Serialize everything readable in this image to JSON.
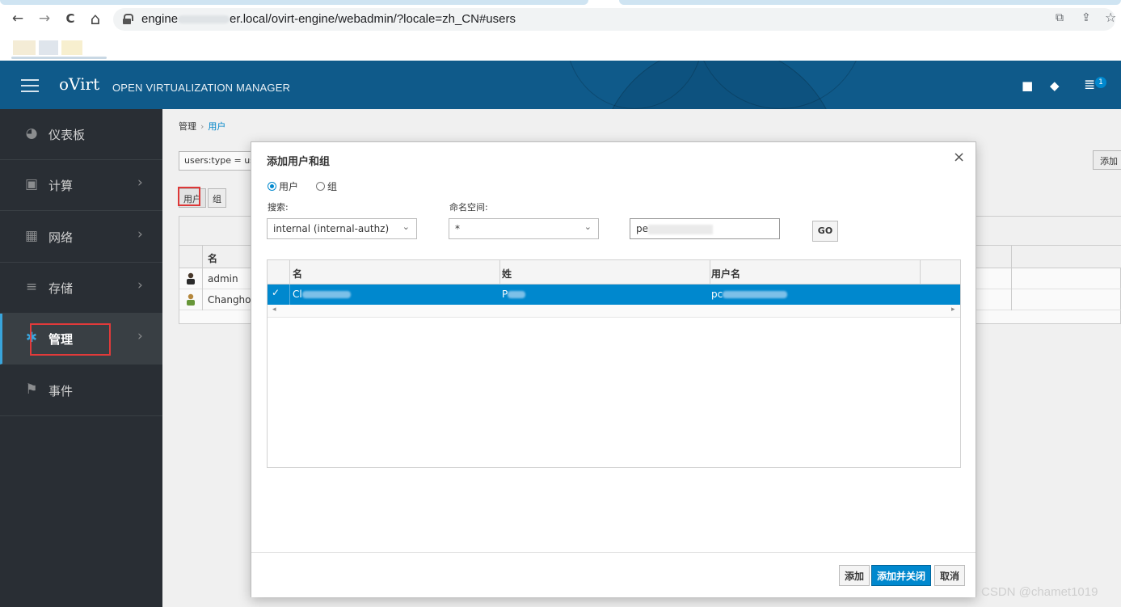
{
  "browser": {
    "url_host_prefix": "engine",
    "url_rest": "er.local/ovirt-engine/webadmin/?locale=zh_CN#users",
    "back_glyph": "←",
    "forward_glyph": "→",
    "reload_glyph": "C",
    "home_glyph": "⌂",
    "translate_glyph": "⧉",
    "share_glyph": "⇪",
    "star_glyph": "☆"
  },
  "header": {
    "brand": "oVirt",
    "subtitle": "OPEN VIRTUALIZATION MANAGER",
    "bookmark_glyph": "■",
    "tag_glyph": "◆",
    "tasks_glyph": "≣",
    "tasks_badge": "1"
  },
  "sidebar": {
    "items": [
      {
        "label": "仪表板",
        "icon": "dashboard-icon",
        "glyph": "◕",
        "has_chevron": false
      },
      {
        "label": "计算",
        "icon": "cpu-icon",
        "glyph": "▣",
        "has_chevron": true
      },
      {
        "label": "网络",
        "icon": "network-icon",
        "glyph": "▦",
        "has_chevron": true
      },
      {
        "label": "存储",
        "icon": "database-icon",
        "glyph": "≡",
        "has_chevron": true
      },
      {
        "label": "管理",
        "icon": "gear-icon",
        "glyph": "✱",
        "has_chevron": true
      },
      {
        "label": "事件",
        "icon": "flag-icon",
        "glyph": "⚑",
        "has_chevron": false
      }
    ],
    "chevron": "›"
  },
  "content": {
    "breadcrumb": [
      "管理",
      "用户"
    ],
    "breadcrumb_sep": "›",
    "search_value": "users:type = us",
    "add_button": "添加",
    "segment_user": "用户",
    "segment_group": "组",
    "table_col_name": "名",
    "rows": [
      "admin",
      "Changhor"
    ]
  },
  "modal": {
    "title": "添加用户和组",
    "close_glyph": "×",
    "radio_user": "用户",
    "radio_group": "组",
    "search_label": "搜索:",
    "search_provider": "internal (internal-authz)",
    "namespace_label": "命名空间:",
    "namespace_value": "*",
    "caret_glyph": "⌄",
    "query_value": "pe",
    "go_button": "GO",
    "columns": [
      "名",
      "姓",
      "用户名"
    ],
    "selected_row": {
      "first": "Cl",
      "last": "P",
      "username": "pc"
    },
    "check_glyph": "✓",
    "scroll_left": "◂",
    "scroll_right": "▸",
    "buttons": {
      "add": "添加",
      "add_close": "添加并关闭",
      "cancel": "取消"
    }
  },
  "watermark": "CSDN @chamet1019",
  "colors": {
    "accent": "#0088ce",
    "header": "#0f5a8a",
    "sidebar": "#292e34",
    "highlight_frame": "#e23a3a"
  }
}
